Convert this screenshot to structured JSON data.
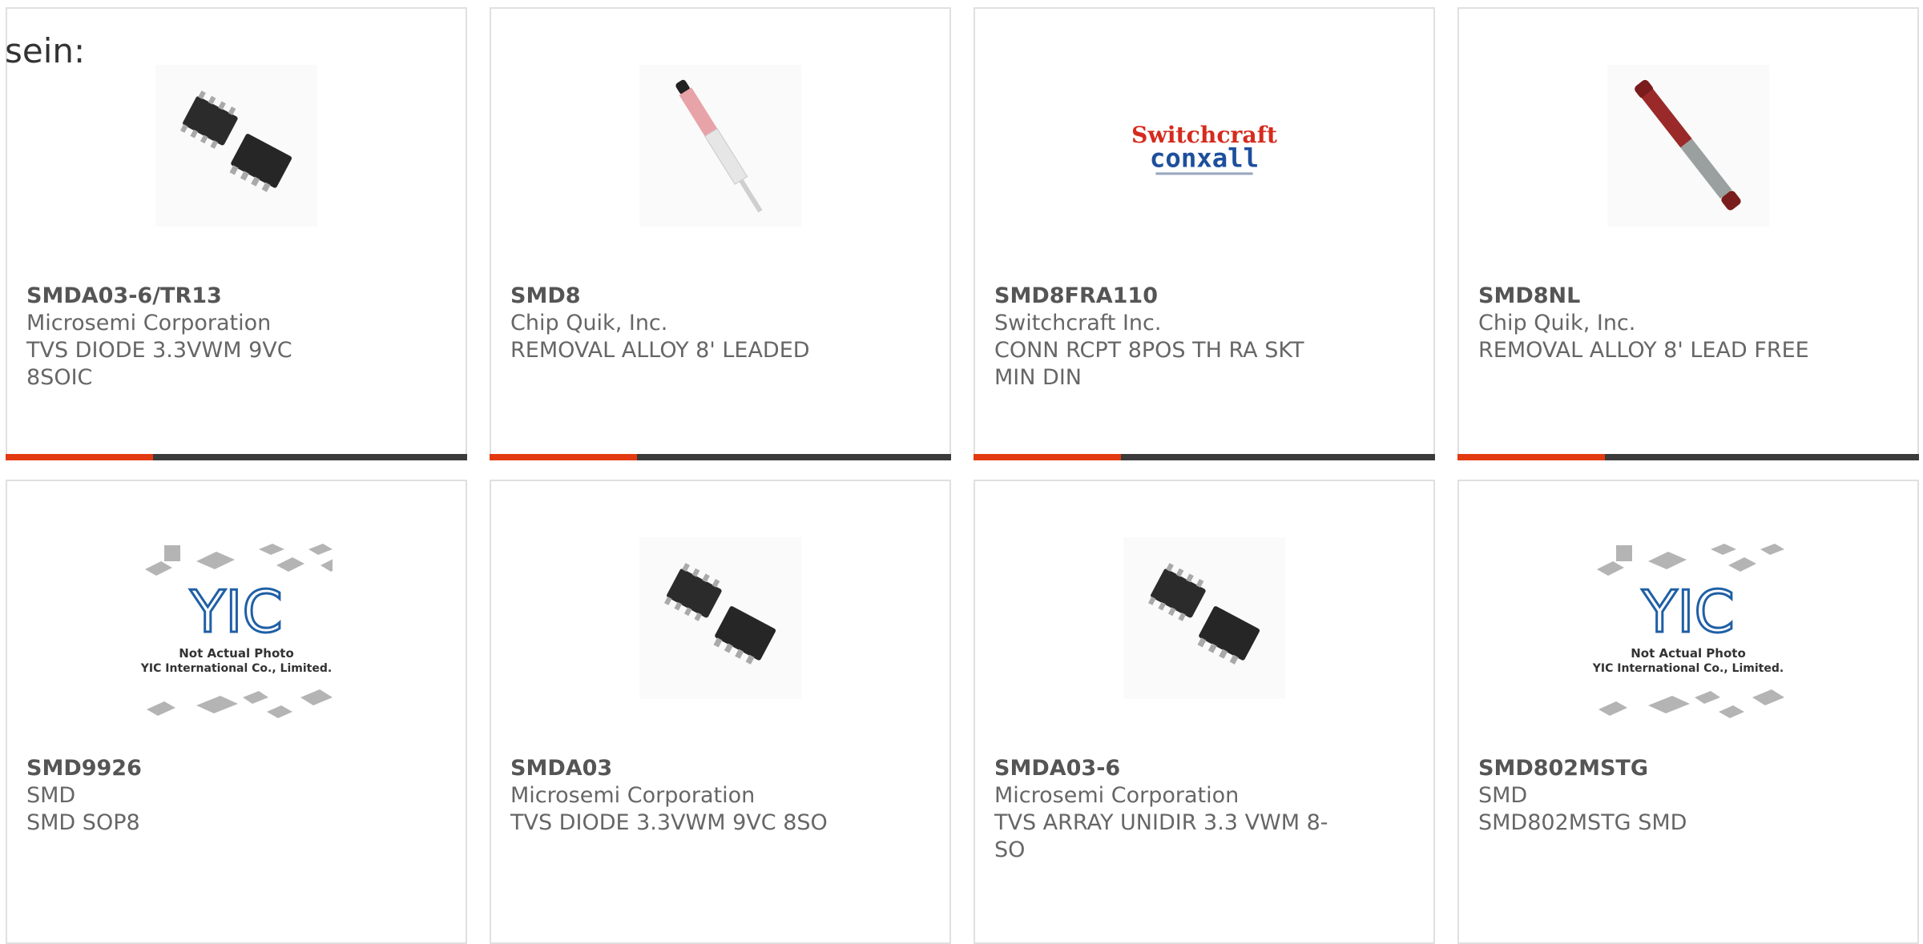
{
  "intro_text": "sein:",
  "colors": {
    "accent": "#e33a12",
    "bar": "#3b3b3b",
    "border": "#e0e0e0",
    "text": "#666666"
  },
  "products": [
    {
      "part": "SMDA03-6/TR13",
      "manufacturer": "Microsemi Corporation",
      "description": "TVS DIODE 3.3VWM 9VC 8SOIC",
      "image": "soic-chip-image"
    },
    {
      "part": "SMD8",
      "manufacturer": "Chip Quik, Inc.",
      "description": "REMOVAL ALLOY 8' LEADED",
      "image": "removal-alloy-tube-image"
    },
    {
      "part": "SMD8FRA110",
      "manufacturer": "Switchcraft Inc.",
      "description": "CONN RCPT 8POS TH RA SKT MIN DIN",
      "image": "switchcraft-logo-image",
      "logo_text": [
        "Switchcraft",
        "conxall"
      ]
    },
    {
      "part": "SMD8NL",
      "manufacturer": "Chip Quik, Inc.",
      "description": "REMOVAL ALLOY 8' LEAD FREE",
      "image": "removal-alloy-tube-image"
    },
    {
      "part": "SMD9926",
      "manufacturer": "SMD",
      "description": "SMD SOP8",
      "image": "not-actual-photo-image",
      "placeholder_text": [
        "YIC",
        "Not Actual Photo",
        "YIC International Co., Limited."
      ]
    },
    {
      "part": "SMDA03",
      "manufacturer": "Microsemi Corporation",
      "description": "TVS DIODE 3.3VWM 9VC 8SO",
      "image": "soic-chip-image"
    },
    {
      "part": "SMDA03-6",
      "manufacturer": "Microsemi Corporation",
      "description": "TVS ARRAY UNIDIR 3.3 VWM 8-SO",
      "image": "soic-chip-image"
    },
    {
      "part": "SMD802MSTG",
      "manufacturer": "SMD",
      "description": "SMD802MSTG SMD",
      "image": "not-actual-photo-image",
      "placeholder_text": [
        "YIC",
        "Not Actual Photo",
        "YIC International Co., Limited."
      ]
    }
  ]
}
